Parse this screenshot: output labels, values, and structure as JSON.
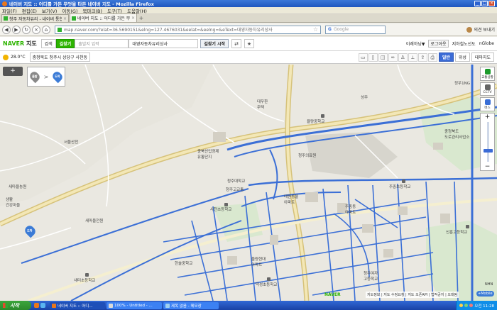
{
  "window": {
    "title": "네이버 지도 :: 어디를 가든 무엇을 타든 네이버 지도 - Mozilla Firefox"
  },
  "menu": [
    "파일(F)",
    "편집(E)",
    "보기(V)",
    "이동(G)",
    "북마크(B)",
    "도구(T)",
    "도움말(H)"
  ],
  "tabs": [
    {
      "label": "청주 자동차유리 - 네이버 통합검색"
    },
    {
      "label": "네이버 지도 :: 어디를 가든 무엇을 ..."
    }
  ],
  "nav": {
    "url": "map.naver.com/?elat=36.5690151&elng=127.4676031&eelat=&eelng=&eText=대영자동차유리상사",
    "search_placeholder": "Google",
    "right_label": "의견 보내기"
  },
  "naver": {
    "logo_n": "NAVER",
    "logo_map": "지도",
    "tab_search": "검색",
    "tab_route": "길찾기",
    "start_placeholder": "출발지 입력",
    "destination_value": "대영자동차유리상사",
    "find_button": "길찾기 시작",
    "right_items": [
      "이래하닝▼",
      "로그아웃",
      "지하철노선도",
      "nGlobe"
    ]
  },
  "info": {
    "temperature": "28.0°C",
    "region": "충청북도 청주시 상당구 사천동",
    "modes": [
      "일반",
      "위성",
      "테마지도"
    ]
  },
  "route_box": {
    "start": "출발",
    "end": "도착"
  },
  "map_labels": {
    "l1": "서울산전",
    "l2": "새마을농원",
    "l3": "생활\n건강마을",
    "l4": "대우환\n주택",
    "l5": "충북산업경제\n유통단지",
    "l6": "청주의료원",
    "l7": "청주고교통",
    "l8": "사천초등학교",
    "l9": "새마을전원",
    "l10": "대원동물\n아파트",
    "l11": "청주대학교",
    "l12": "주중초등학교",
    "l13": "율량중학교",
    "l14": "충청북도\n도로관리사업소",
    "l15": "신흥고등학교",
    "l16": "청주여자\n고등학교",
    "l17": "덕성초등학교",
    "l18": "새터초등학교",
    "l19": "한솔중학교",
    "l20": "주중동\n아파트",
    "l21": "율량현대\n아파트",
    "l22": "정우1NG",
    "l23": "성무"
  },
  "right_panel": {
    "traffic": "교통상황",
    "cctv": "CCTV",
    "bus": "버스"
  },
  "footer": {
    "scale": "지도정보 | 지도 수정요청 | 지도 오픈API | 법적공지 | 오래됨",
    "naver_mark": "NAVER",
    "mobile": "+Mobile",
    "compass": "NHN"
  },
  "taskbar": {
    "start": "시작",
    "buttons": [
      "네이버 지도 :: 어디...",
      "100% - Untitled - ...",
      "제목 없음 - 메모장"
    ],
    "clock": "오전 11:28"
  },
  "colors": {
    "naver_green": "#2db400",
    "road_blue": "#3b6fd6",
    "highway_gold": "#d6c27a",
    "map_bg": "#eae8e1"
  }
}
